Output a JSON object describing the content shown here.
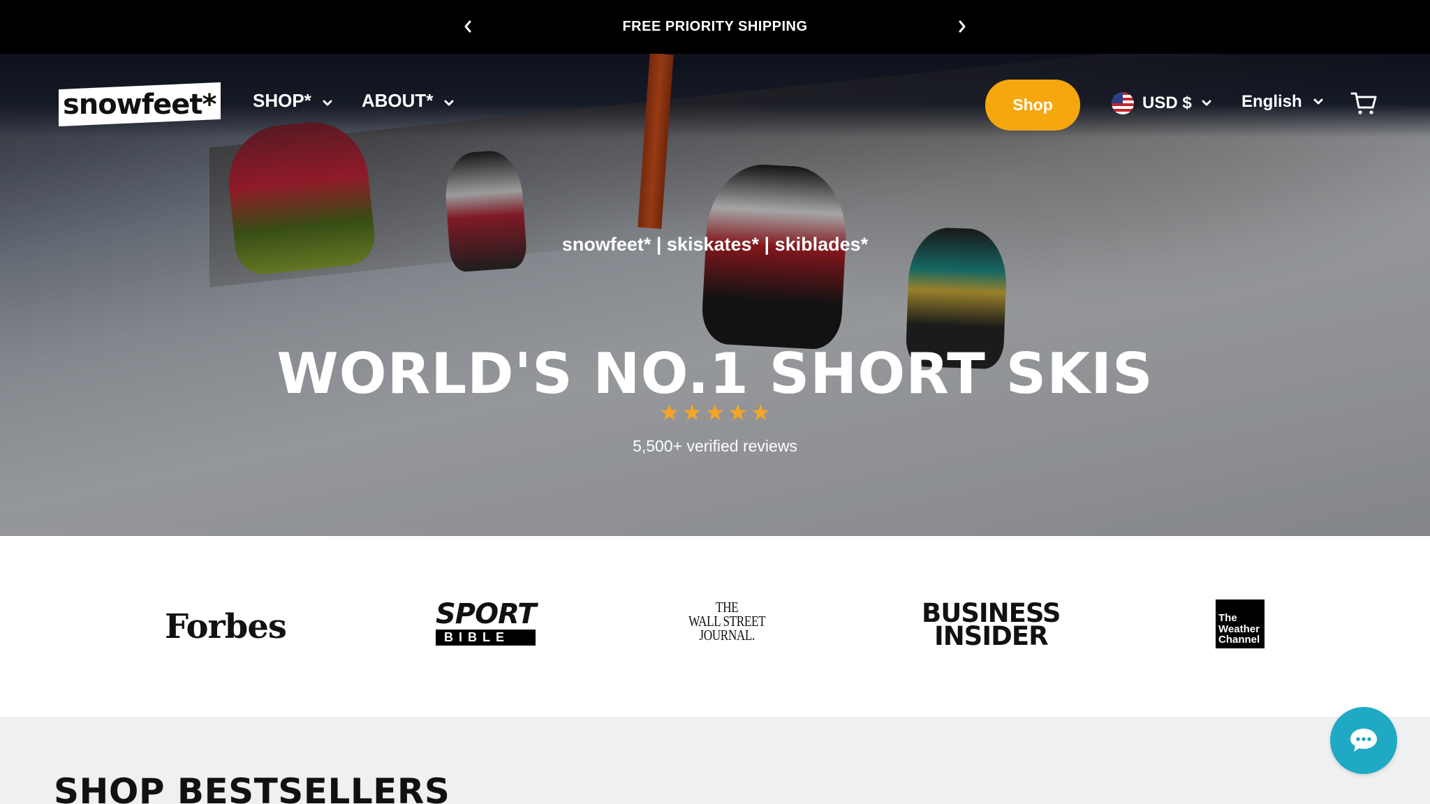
{
  "announcement": {
    "text": "FREE PRIORITY SHIPPING",
    "prev_icon": "chevron-left-icon",
    "next_icon": "chevron-right-icon"
  },
  "header": {
    "logo_text": "snowfeet*",
    "nav": [
      {
        "label": "SHOP*",
        "icon": "chevron-down-icon"
      },
      {
        "label": "ABOUT*",
        "icon": "chevron-down-icon"
      }
    ],
    "shop_button": "Shop",
    "currency": {
      "label": "USD $",
      "flag": "us-flag-icon"
    },
    "language": "English",
    "cart_icon": "cart-icon"
  },
  "hero": {
    "tagline": "snowfeet* | skiskates* | skiblades*",
    "headline": "WORLD'S NO.1 SHORT SKIS",
    "rating_stars": 5,
    "reviews_text": "5,500+ verified reviews"
  },
  "press": {
    "logos": [
      "Forbes",
      "SPORT",
      "BIBLE",
      "THE",
      "WALL STREET",
      "JOURNAL.",
      "BUSINESS",
      "INSIDER",
      "The",
      "Weather",
      "Channel"
    ]
  },
  "bestsellers": {
    "title": "SHOP BESTSELLERS"
  },
  "chat": {
    "icon": "chat-bubble-icon"
  },
  "colors": {
    "accent": "#f6a70d",
    "star": "#f6a623",
    "chat": "#1fa9c4",
    "announcement_bg": "#000000",
    "section_bg": "#eff0f2"
  }
}
